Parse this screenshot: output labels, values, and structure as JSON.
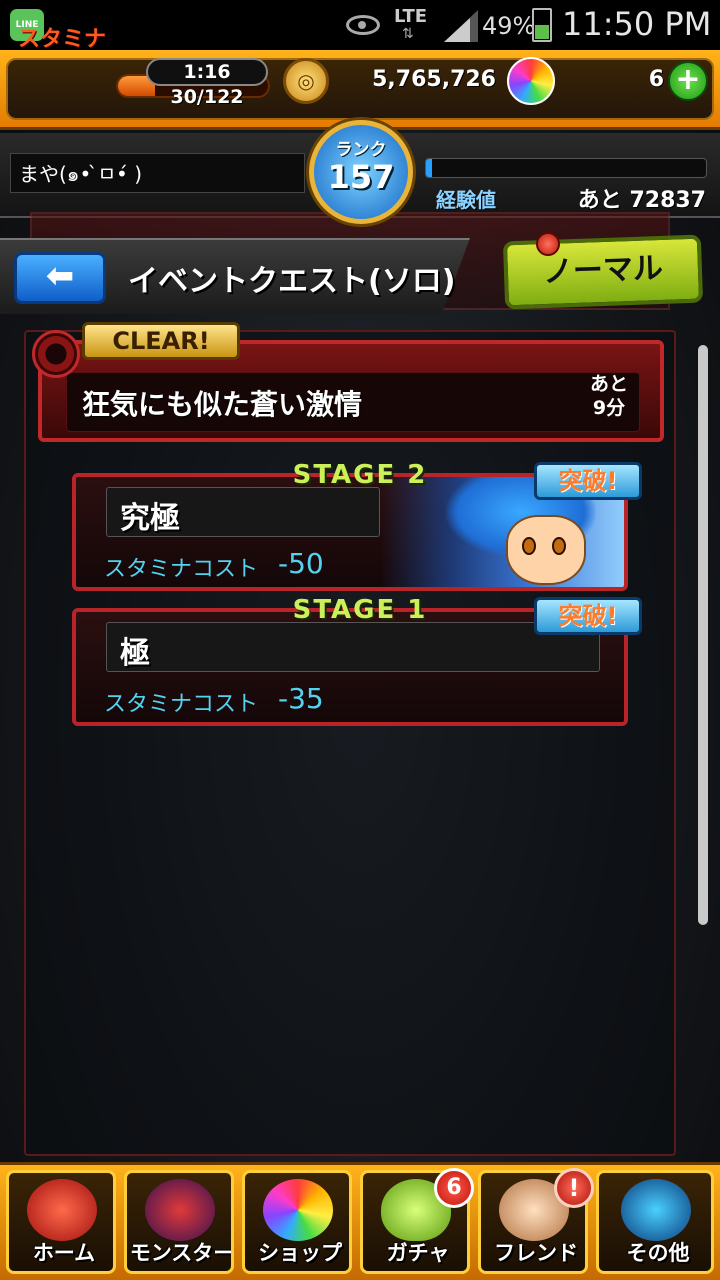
{
  "status_bar": {
    "network": "LTE",
    "battery": "49%",
    "time": "11:50 PM",
    "app_badge": "LINE"
  },
  "hud": {
    "stamina_label": "スタミナ",
    "stamina_timer": "1:16",
    "stamina_value": "30/122",
    "stamina_fraction": 0.246,
    "gold": "5,765,726",
    "orb_count": "6",
    "plus": "+"
  },
  "player": {
    "name": "まや(๑• ̀ㅁ•́ )",
    "rank_label": "ランク",
    "rank": "157",
    "exp_label": "経験値",
    "exp_remaining": "あと 72837",
    "exp_fraction": 0.02
  },
  "header": {
    "back": "⬅",
    "title": "イベントクエスト(ソロ)",
    "difficulty": "ノーマル"
  },
  "event": {
    "clear_badge": "CLEAR!",
    "name": "狂気にも似た蒼い激情",
    "time_remaining": "あと\n9分"
  },
  "stages": [
    {
      "label": "STAGE 2",
      "name": "究極",
      "cost_label": "スタミナコスト",
      "cost": "-50",
      "badge": "突破!"
    },
    {
      "label": "STAGE 1",
      "name": "極",
      "cost_label": "スタミナコスト",
      "cost": "-35",
      "badge": "突破!"
    }
  ],
  "nav": [
    {
      "label": "ホーム",
      "icon": "home-dragon-icon"
    },
    {
      "label": "モンスター",
      "icon": "monster-icon"
    },
    {
      "label": "ショップ",
      "icon": "orb-shop-icon"
    },
    {
      "label": "ガチャ",
      "icon": "gacha-egg-icon",
      "badge": "6"
    },
    {
      "label": "フレンド",
      "icon": "handshake-icon",
      "badge": "!"
    },
    {
      "label": "その他",
      "icon": "radar-icon"
    }
  ],
  "colors": {
    "hud_orange": "#ffb31a",
    "panel_red": "#c0282a",
    "cost_cyan": "#53d3f0",
    "stage_green": "#ccf05a"
  }
}
